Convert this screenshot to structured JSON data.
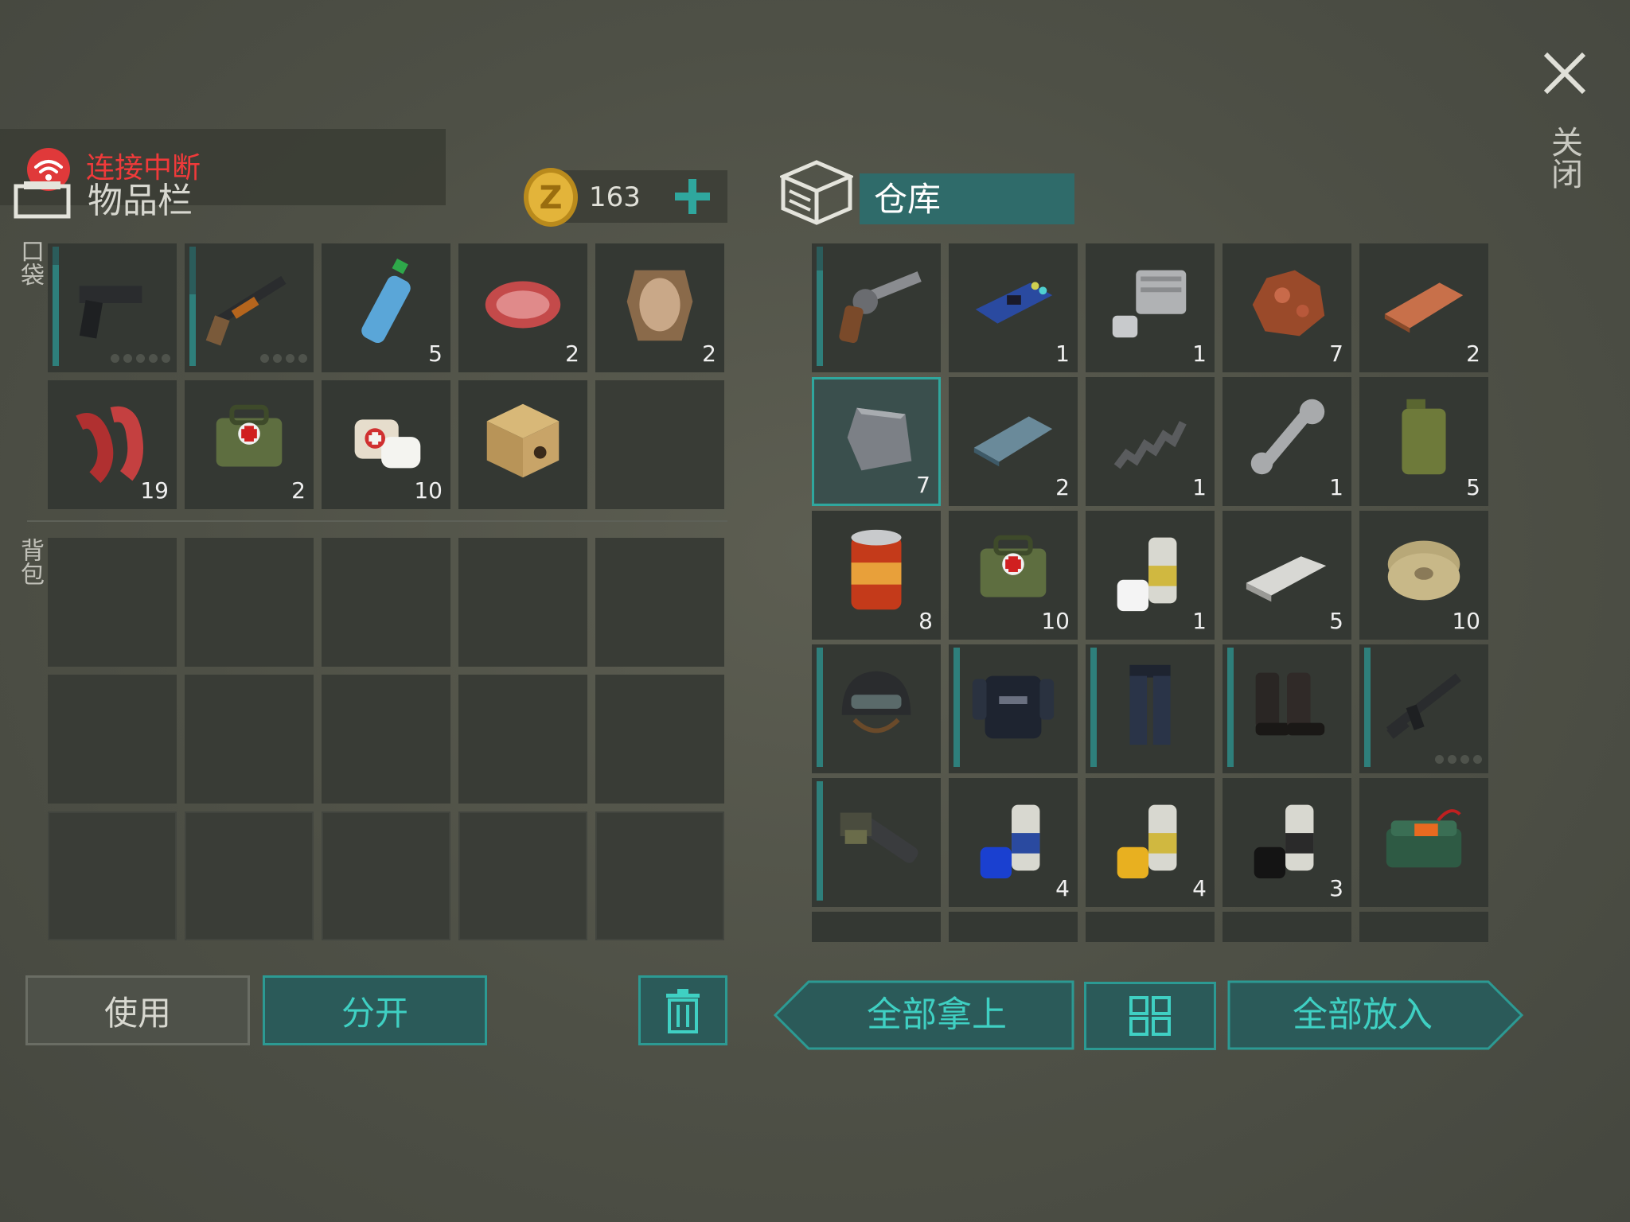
{
  "status": {
    "text": "连接中断"
  },
  "inventory": {
    "title": "物品栏",
    "coins": "163",
    "pocket_label": "口袋",
    "backpack_label": "背包",
    "pocket_slots": [
      {
        "item": "pistol-icon",
        "qty": "",
        "durability": 0.85,
        "ammo_dots": 5
      },
      {
        "item": "shotgun-icon",
        "qty": "",
        "durability": 0.6,
        "ammo_dots": 4
      },
      {
        "item": "water-bottle-icon",
        "qty": "5"
      },
      {
        "item": "raw-meat-icon",
        "qty": "2"
      },
      {
        "item": "animal-hide-icon",
        "qty": "2"
      },
      {
        "item": "bacon-icon",
        "qty": "19"
      },
      {
        "item": "medkit-bag-icon",
        "qty": "2"
      },
      {
        "item": "bandage-icon",
        "qty": "10"
      },
      {
        "item": "pet-box-icon",
        "qty": ""
      },
      {
        "item": "",
        "qty": ""
      }
    ]
  },
  "storage": {
    "title": "仓库",
    "slots": [
      {
        "item": "revolver-icon",
        "qty": "",
        "durability": 0.8
      },
      {
        "item": "circuit-board-icon",
        "qty": "1"
      },
      {
        "item": "engine-cylinder-icon",
        "qty": "1"
      },
      {
        "item": "copper-ore-icon",
        "qty": "7"
      },
      {
        "item": "copper-ingot-icon",
        "qty": "2"
      },
      {
        "item": "metal-plate-icon",
        "qty": "7",
        "selected": true
      },
      {
        "item": "steel-ingot-icon",
        "qty": "2"
      },
      {
        "item": "spring-icon",
        "qty": "1"
      },
      {
        "item": "wrench-icon",
        "qty": "1"
      },
      {
        "item": "jerrycan-icon",
        "qty": "5"
      },
      {
        "item": "canned-food-icon",
        "qty": "8"
      },
      {
        "item": "medkit-bag-icon",
        "qty": "10"
      },
      {
        "item": "spray-paint-white-icon",
        "qty": "1"
      },
      {
        "item": "aluminum-bar-icon",
        "qty": "5"
      },
      {
        "item": "wire-spool-icon",
        "qty": "10"
      },
      {
        "item": "helmet-icon",
        "qty": "",
        "durability": 1.0
      },
      {
        "item": "police-vest-icon",
        "qty": "",
        "durability": 1.0
      },
      {
        "item": "police-pants-icon",
        "qty": "",
        "durability": 1.0
      },
      {
        "item": "boots-icon",
        "qty": "",
        "durability": 1.0
      },
      {
        "item": "assault-rifle-icon",
        "qty": "",
        "durability": 1.0,
        "ammo_dots": 4
      },
      {
        "item": "minigun-icon",
        "qty": "",
        "durability": 1.0
      },
      {
        "item": "spray-paint-blue-icon",
        "qty": "4"
      },
      {
        "item": "spray-paint-yellow-icon",
        "qty": "4"
      },
      {
        "item": "spray-paint-black-icon",
        "qty": "3"
      },
      {
        "item": "c4-explosive-icon",
        "qty": ""
      }
    ]
  },
  "buttons": {
    "use": "使用",
    "split": "分开",
    "take_all": "全部拿上",
    "put_all": "全部放入",
    "close": "关闭"
  },
  "colors": {
    "accent": "#2c9a93",
    "accent_text": "#3fd0c3",
    "status_red": "#f03a3a"
  }
}
